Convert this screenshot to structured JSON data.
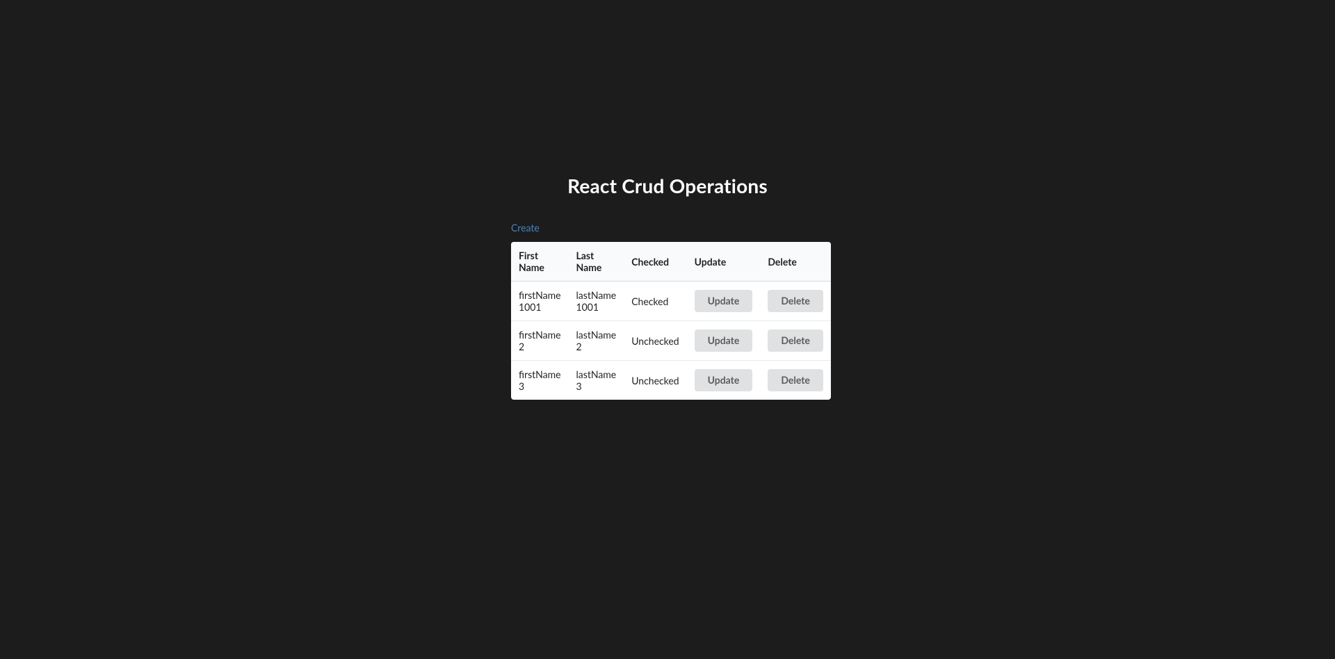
{
  "title": "React Crud Operations",
  "create_label": "Create",
  "columns": {
    "first_name": "First Name",
    "last_name": "Last Name",
    "checked": "Checked",
    "update": "Update",
    "delete": "Delete"
  },
  "buttons": {
    "update": "Update",
    "delete": "Delete"
  },
  "rows": [
    {
      "first_name": "firstName 1001",
      "last_name": "lastName 1001",
      "checked": "Checked"
    },
    {
      "first_name": "firstName 2",
      "last_name": "lastName 2",
      "checked": "Unchecked"
    },
    {
      "first_name": "firstName 3",
      "last_name": "lastName 3",
      "checked": "Unchecked"
    }
  ]
}
